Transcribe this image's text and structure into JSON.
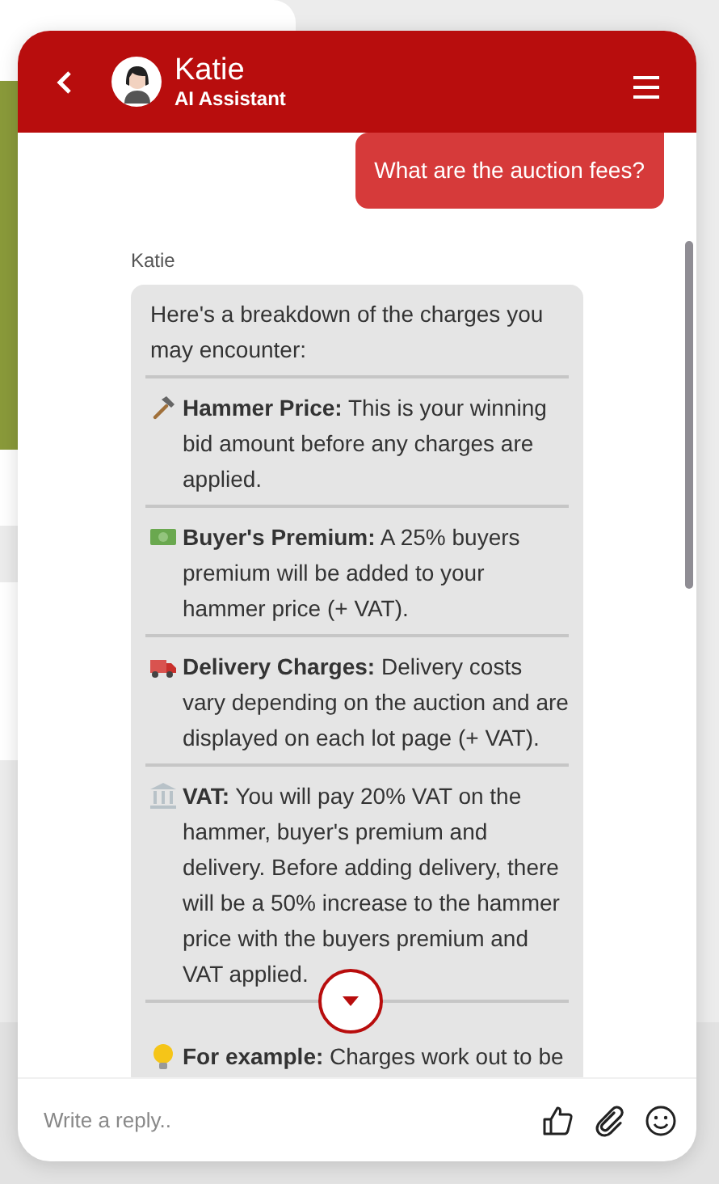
{
  "header": {
    "name": "Katie",
    "subtitle": "AI Assistant"
  },
  "messages": [
    {
      "kind": "user",
      "text": "What are the auction fees?"
    },
    {
      "kind": "bot",
      "sender": "Katie",
      "intro": "Here's a breakdown of the charges you may encounter:",
      "sections": [
        {
          "kind": "hammer",
          "title": "Hammer Price:",
          "text": "This is your winning bid amount before any charges are applied."
        },
        {
          "kind": "money",
          "title": "Buyer's Premium:",
          "text": "A 25% buyers premium will be added to your hammer price (+ VAT)."
        },
        {
          "kind": "truck",
          "title": "Delivery Charges:",
          "text": "Delivery costs vary depending on the auction and are displayed on each lot page (+ VAT)."
        },
        {
          "kind": "bank",
          "title": "VAT:",
          "text": "You will pay 20% VAT on the hammer, buyer's premium and delivery. Before adding delivery, there will be a 50% increase to the hammer price with the buyers premium and VAT applied."
        },
        {
          "kind": "bulb",
          "title": "For example:",
          "text": "Charges work out to be"
        }
      ]
    }
  ],
  "composer": {
    "placeholder": "Write a reply.."
  }
}
